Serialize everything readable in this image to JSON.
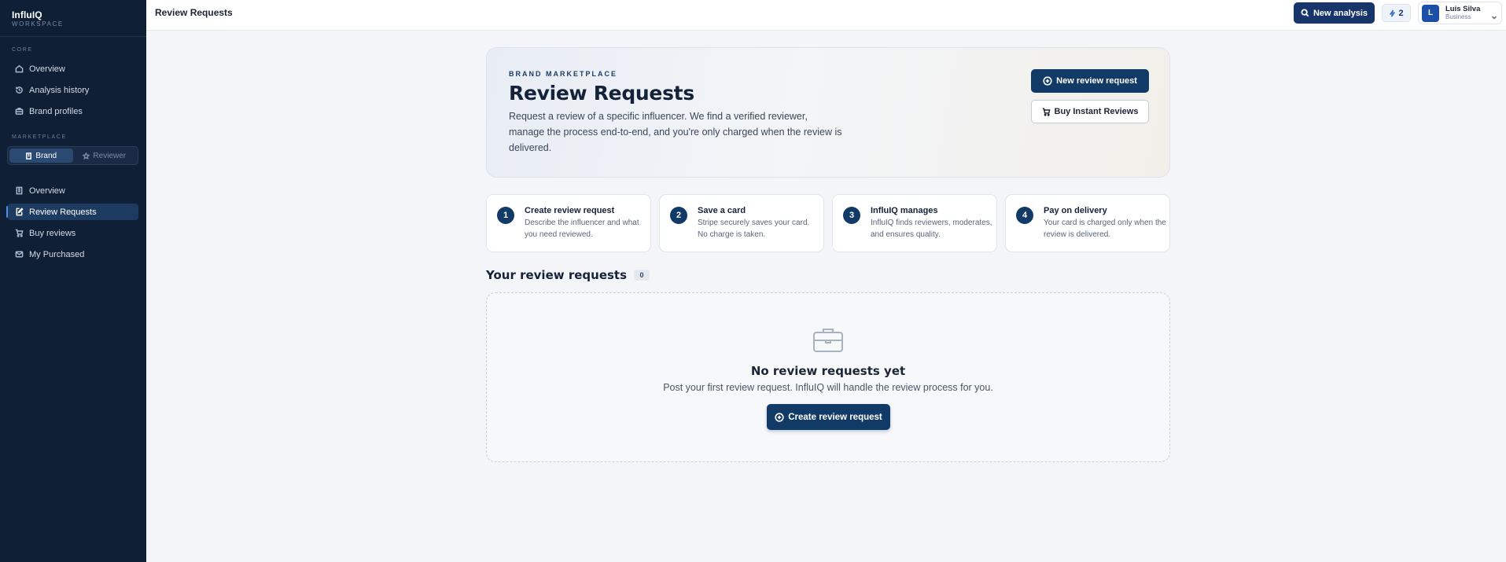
{
  "app": {
    "name": "InfluIQ",
    "subtitle": "WORKSPACE"
  },
  "sidebar": {
    "core_label": "CORE",
    "core_items": [
      {
        "label": "Overview",
        "icon": "home-icon"
      },
      {
        "label": "Analysis history",
        "icon": "history-icon"
      },
      {
        "label": "Brand profiles",
        "icon": "briefcase-icon"
      }
    ],
    "marketplace_label": "MARKETPLACE",
    "toggle": {
      "brand": "Brand",
      "reviewer": "Reviewer",
      "selected": "Brand"
    },
    "marketplace_items": [
      {
        "label": "Overview",
        "icon": "building-icon"
      },
      {
        "label": "Review Requests",
        "icon": "edit-icon",
        "active": true
      },
      {
        "label": "Buy reviews",
        "icon": "cart-icon"
      },
      {
        "label": "My Purchased",
        "icon": "mail-icon"
      }
    ]
  },
  "topbar": {
    "title": "Review Requests",
    "new_analysis": "New analysis",
    "credits": "2",
    "user": {
      "initial": "L",
      "name": "Luis Silva",
      "plan": "Business"
    }
  },
  "hero": {
    "eyebrow": "BRAND MARKETPLACE",
    "title": "Review Requests",
    "description": "Request a review of a specific influencer. We find a verified reviewer, manage the process end-to-end, and you're only charged when the review is delivered.",
    "primary_button": "New review request",
    "secondary_button": "Buy Instant Reviews"
  },
  "steps": [
    {
      "num": "1",
      "title": "Create review request",
      "desc": "Describe the influencer and what you need reviewed."
    },
    {
      "num": "2",
      "title": "Save a card",
      "desc": "Stripe securely saves your card. No charge is taken."
    },
    {
      "num": "3",
      "title": "InfluIQ manages",
      "desc": "InfluIQ finds reviewers, moderates, and ensures quality."
    },
    {
      "num": "4",
      "title": "Pay on delivery",
      "desc": "Your card is charged only when the review is delivered."
    }
  ],
  "requests": {
    "title": "Your review requests",
    "count": "0",
    "empty_title": "No review requests yet",
    "empty_sub": "Post your first review request. InfluIQ will handle the review process for you.",
    "create_button": "Create review request"
  },
  "colors": {
    "sidebar_bg": "#0f1f35",
    "accent": "#123a66",
    "page_bg": "#f4f5f8"
  }
}
